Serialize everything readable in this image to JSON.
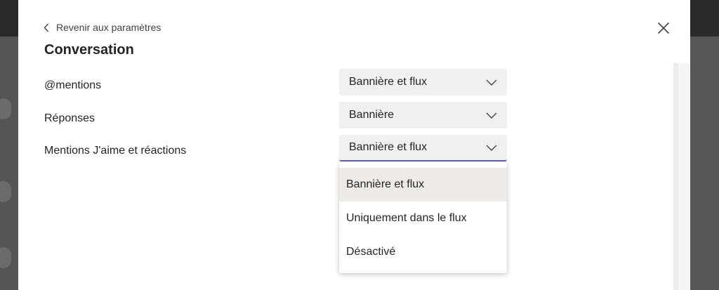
{
  "header": {
    "back_label": "Revenir aux paramètres",
    "title": "Conversation"
  },
  "settings": [
    {
      "label": "@mentions",
      "value": "Bannière et flux"
    },
    {
      "label": "Réponses",
      "value": "Bannière"
    },
    {
      "label": "Mentions J'aime et réactions",
      "value": "Bannière et flux"
    }
  ],
  "dropdown": {
    "options": [
      "Bannière et flux",
      "Uniquement dans le flux",
      "Désactivé"
    ],
    "selected": "Bannière et flux"
  },
  "icons": {
    "back": "chevron-left-icon",
    "close": "close-icon",
    "expand": "chevron-down-icon"
  },
  "colors": {
    "accent": "#6264a7",
    "selected_option_bg": "#edebe9",
    "select_bg": "#f0f0f0"
  }
}
